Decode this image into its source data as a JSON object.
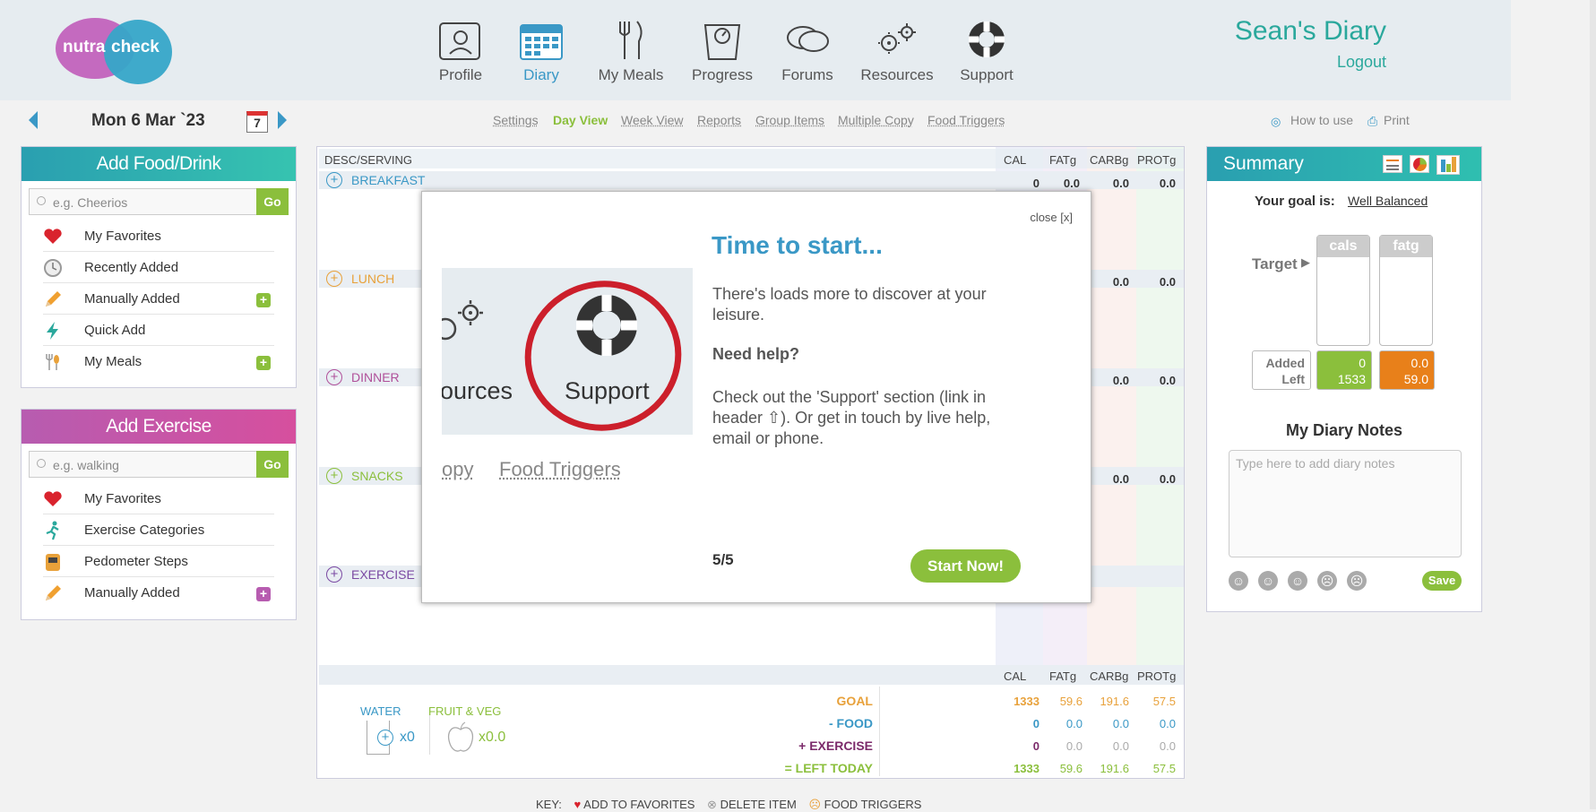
{
  "header": {
    "logo_line1": "nutra",
    "logo_line2": "check",
    "nav": [
      {
        "label": "Profile",
        "icon": "profile-icon"
      },
      {
        "label": "Diary",
        "icon": "diary-icon"
      },
      {
        "label": "My Meals",
        "icon": "cutlery-icon"
      },
      {
        "label": "Progress",
        "icon": "scale-icon"
      },
      {
        "label": "Forums",
        "icon": "speech-bubbles-icon"
      },
      {
        "label": "Resources",
        "icon": "gears-icon"
      },
      {
        "label": "Support",
        "icon": "lifebuoy-icon"
      }
    ],
    "diary_title": "Sean's Diary",
    "logout": "Logout"
  },
  "date_bar": {
    "date": "Mon 6 Mar `23",
    "calendar_day": "7",
    "views": [
      "Settings",
      "Day View",
      "Week View",
      "Reports",
      "Group Items",
      "Multiple Copy",
      "Food Triggers"
    ],
    "active_view": "Day View",
    "how_to_use": "How to use",
    "print": "Print"
  },
  "add_food": {
    "title": "Add Food/Drink",
    "placeholder": "e.g. Cheerios",
    "go": "Go",
    "items": [
      "My Favorites",
      "Recently Added",
      "Manually Added",
      "Quick Add",
      "My Meals"
    ]
  },
  "add_exercise": {
    "title": "Add Exercise",
    "placeholder": "e.g. walking",
    "go": "Go",
    "items": [
      "My Favorites",
      "Exercise Categories",
      "Pedometer Steps",
      "Manually Added"
    ]
  },
  "grid": {
    "headers": [
      "DESC/SERVING",
      "CAL",
      "FATg",
      "CARBg",
      "PROTg"
    ],
    "meals": [
      {
        "name": "BREAKFAST",
        "color": "#3a98c6",
        "cal": "0",
        "fat": "0.0",
        "carb": "0.0",
        "prot": "0.0"
      },
      {
        "name": "LUNCH",
        "color": "#e8a13a",
        "fat": "0.0",
        "carb": "0.0"
      },
      {
        "name": "DINNER",
        "color": "#b0509a",
        "fat": "0.0",
        "carb": "0.0"
      },
      {
        "name": "SNACKS",
        "color": "#8bbf3c",
        "fat": "0.0",
        "carb": "0.0"
      },
      {
        "name": "EXERCISE",
        "color": "#7b4aa3"
      }
    ],
    "footer_headers": [
      "CAL",
      "FATg",
      "CARBg",
      "PROTg"
    ],
    "water_label": "WATER",
    "water_count": "x0",
    "fruit_label": "FRUIT & VEG",
    "fruit_count": "x0.0",
    "totals": [
      {
        "label": "GOAL",
        "color": "#e8a13a",
        "cal": "1333",
        "fat": "59.6",
        "carb": "191.6",
        "prot": "57.5"
      },
      {
        "label": "- FOOD",
        "color": "#3a98c6",
        "cal": "0",
        "fat": "0.0",
        "carb": "0.0",
        "prot": "0.0"
      },
      {
        "label": "+ EXERCISE",
        "color": "#7b2a6a",
        "cal": "0",
        "fat": "0.0",
        "carb": "0.0",
        "prot": "0.0"
      },
      {
        "label": "= LEFT TODAY",
        "color": "#8bbf3c",
        "cal": "1333",
        "fat": "59.6",
        "carb": "191.6",
        "prot": "57.5"
      }
    ]
  },
  "overlay": {
    "close": "close [x]",
    "title": "Time to start...",
    "p1": "There's loads more to discover at your leisure.",
    "help": "Need help?",
    "p2": "Check out the 'Support' section (link in header ⇧). Or get in touch by live help, email or phone.",
    "image_resources": "ources",
    "image_support": "Support",
    "image_copy": "opy",
    "image_food_triggers": "Food Triggers",
    "page": "5/5",
    "start": "Start Now!"
  },
  "summary": {
    "title": "Summary",
    "goal_label": "Your goal is:",
    "goal_value": "Well Balanced",
    "target": "Target",
    "bars": [
      "cals",
      "fatg"
    ],
    "added_label": "Added",
    "left_label": "Left",
    "cals_added": "0",
    "cals_left": "1533",
    "fat_added": "0.0",
    "fat_left": "59.0",
    "notes_title": "My Diary Notes",
    "notes_placeholder": "Type here to add diary notes",
    "save": "Save"
  },
  "key": {
    "label": "KEY:",
    "items": [
      "ADD TO FAVORITES",
      "DELETE ITEM",
      "FOOD TRIGGERS"
    ]
  },
  "colors": {
    "teal": "#2aa89c",
    "blue": "#3a98c6",
    "green": "#8bbf3c",
    "magenta": "#c45aa8",
    "orange": "#e8801a"
  }
}
